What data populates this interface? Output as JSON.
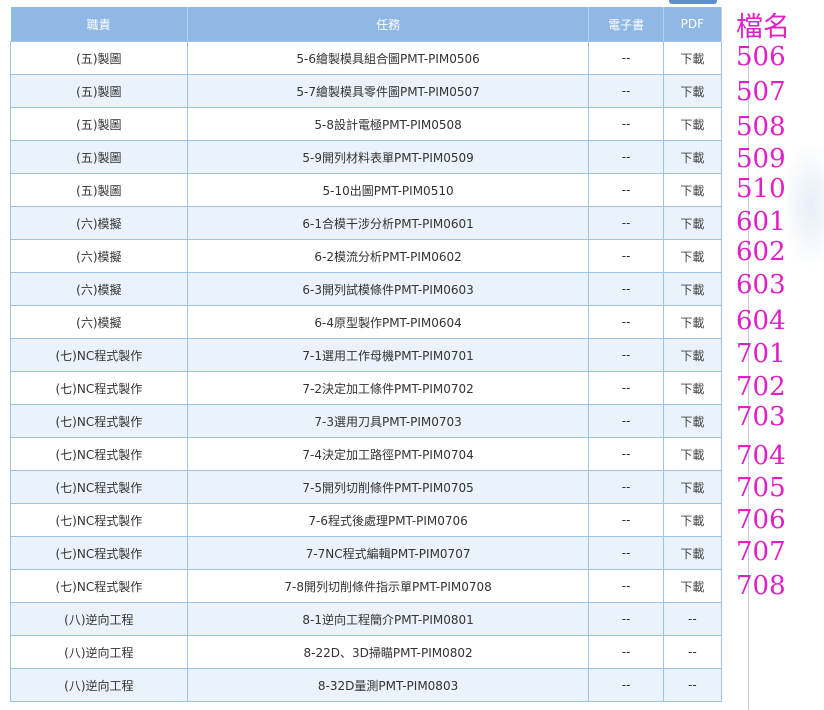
{
  "table": {
    "headers": {
      "duty": "職責",
      "task": "任務",
      "ebook": "電子書",
      "pdf": "PDF"
    },
    "rows": [
      {
        "duty": "(五)製圖",
        "task": "5-6繪製模具組合圖PMT-PIM0506",
        "ebook": "--",
        "pdf": "下載"
      },
      {
        "duty": "(五)製圖",
        "task": "5-7繪製模具零件圖PMT-PIM0507",
        "ebook": "--",
        "pdf": "下載"
      },
      {
        "duty": "(五)製圖",
        "task": "5-8設計電極PMT-PIM0508",
        "ebook": "--",
        "pdf": "下載"
      },
      {
        "duty": "(五)製圖",
        "task": "5-9開列材料表單PMT-PIM0509",
        "ebook": "--",
        "pdf": "下載"
      },
      {
        "duty": "(五)製圖",
        "task": "5-10出圖PMT-PIM0510",
        "ebook": "--",
        "pdf": "下載"
      },
      {
        "duty": "(六)模擬",
        "task": "6-1合模干涉分析PMT-PIM0601",
        "ebook": "--",
        "pdf": "下載"
      },
      {
        "duty": "(六)模擬",
        "task": "6-2模流分析PMT-PIM0602",
        "ebook": "--",
        "pdf": "下載"
      },
      {
        "duty": "(六)模擬",
        "task": "6-3開列試模條件PMT-PIM0603",
        "ebook": "--",
        "pdf": "下載"
      },
      {
        "duty": "(六)模擬",
        "task": "6-4原型製作PMT-PIM0604",
        "ebook": "--",
        "pdf": "下載"
      },
      {
        "duty": "(七)NC程式製作",
        "task": "7-1選用工作母機PMT-PIM0701",
        "ebook": "--",
        "pdf": "下載"
      },
      {
        "duty": "(七)NC程式製作",
        "task": "7-2決定加工條件PMT-PIM0702",
        "ebook": "--",
        "pdf": "下載"
      },
      {
        "duty": "(七)NC程式製作",
        "task": "7-3選用刀具PMT-PIM0703",
        "ebook": "--",
        "pdf": "下載"
      },
      {
        "duty": "(七)NC程式製作",
        "task": "7-4決定加工路徑PMT-PIM0704",
        "ebook": "--",
        "pdf": "下載"
      },
      {
        "duty": "(七)NC程式製作",
        "task": "7-5開列切削條件PMT-PIM0705",
        "ebook": "--",
        "pdf": "下載"
      },
      {
        "duty": "(七)NC程式製作",
        "task": "7-6程式後處理PMT-PIM0706",
        "ebook": "--",
        "pdf": "下載"
      },
      {
        "duty": "(七)NC程式製作",
        "task": "7-7NC程式編輯PMT-PIM0707",
        "ebook": "--",
        "pdf": "下載"
      },
      {
        "duty": "(七)NC程式製作",
        "task": "7-8開列切削條件指示單PMT-PIM0708",
        "ebook": "--",
        "pdf": "下載"
      },
      {
        "duty": "(八)逆向工程",
        "task": "8-1逆向工程簡介PMT-PIM0801",
        "ebook": "--",
        "pdf": "--"
      },
      {
        "duty": "(八)逆向工程",
        "task": "8-22D、3D掃瞄PMT-PIM0802",
        "ebook": "--",
        "pdf": "--"
      },
      {
        "duty": "(八)逆向工程",
        "task": "8-32D量測PMT-PIM0803",
        "ebook": "--",
        "pdf": "--"
      }
    ]
  },
  "annotations": {
    "header": "檔名",
    "labels": [
      "506",
      "507",
      "508",
      "509",
      "510",
      "601",
      "602",
      "603",
      "604",
      "701",
      "702",
      "703",
      "704",
      "705",
      "706",
      "707",
      "708"
    ]
  }
}
